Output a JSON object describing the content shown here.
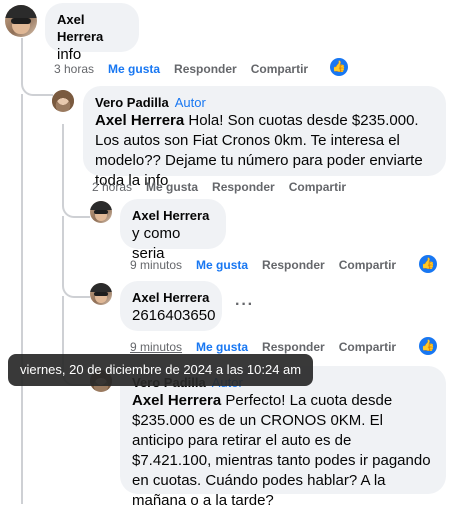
{
  "comment1": {
    "author": "Axel Herrera",
    "text": "info",
    "time": "3 horas",
    "like": "Me gusta",
    "reply": "Responder",
    "share": "Compartir"
  },
  "comment2": {
    "author": "Vero Padilla",
    "role": "Autor",
    "mention": "Axel Herrera",
    "text": "Hola! Son cuotas desde $235.000. Los autos son Fiat Cronos 0km. Te interesa el modelo?? Dejame tu número para poder enviarte toda la info",
    "time": "2 horas",
    "like": "Me gusta",
    "reply": "Responder",
    "share": "Compartir"
  },
  "comment3": {
    "author": "Axel Herrera",
    "text": "y como seria",
    "time": "9 minutos",
    "like": "Me gusta",
    "reply": "Responder",
    "share": "Compartir"
  },
  "comment4": {
    "author": "Axel Herrera",
    "text": "2616403650",
    "time": "9 minutos",
    "like": "Me gusta",
    "reply": "Responder",
    "share": "Compartir",
    "more": "···"
  },
  "comment5": {
    "author": "Vero Padilla",
    "role": "Autor",
    "mention": "Axel Herrera",
    "text": "Perfecto! La cuota desde $235.000 es de un CRONOS 0KM. El anticipo para retirar el auto es de $7.421.100, mientras tanto podes ir pagando en cuotas. Cuándo podes hablar? A la mañana o a la tarde?"
  },
  "tooltip": "viernes, 20 de diciembre de 2024 a las 10:24 am",
  "colors": {
    "accent": "#1877f2",
    "bubble": "#f0f2f5",
    "muted": "#65676b"
  }
}
